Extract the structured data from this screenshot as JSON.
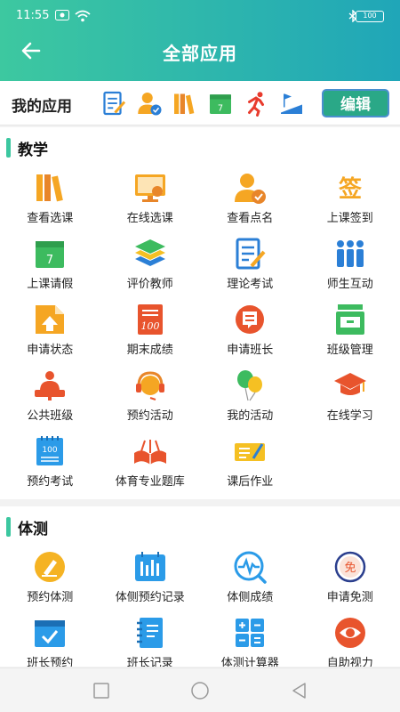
{
  "status": {
    "time": "11:55",
    "battery": "100"
  },
  "header": {
    "title": "全部应用"
  },
  "my_apps": {
    "label": "我的应用",
    "edit": "编辑",
    "icons": [
      "checklist-icon",
      "person-check-icon",
      "books-icon",
      "calendar-icon",
      "runner-icon",
      "podium-icon"
    ]
  },
  "sections": [
    {
      "title": "教学",
      "items": [
        {
          "label": "查看选课",
          "icon": "books-icon"
        },
        {
          "label": "在线选课",
          "icon": "monitor-icon"
        },
        {
          "label": "查看点名",
          "icon": "person-check-icon"
        },
        {
          "label": "上课签到",
          "icon": "sign-icon"
        },
        {
          "label": "上课请假",
          "icon": "calendar-icon"
        },
        {
          "label": "评价教师",
          "icon": "layers-icon"
        },
        {
          "label": "理论考试",
          "icon": "exam-icon"
        },
        {
          "label": "师生互动",
          "icon": "group-icon"
        },
        {
          "label": "申请状态",
          "icon": "upload-icon"
        },
        {
          "label": "期末成绩",
          "icon": "score-icon"
        },
        {
          "label": "申请班长",
          "icon": "chat-icon"
        },
        {
          "label": "班级管理",
          "icon": "cabinet-icon"
        },
        {
          "label": "公共班级",
          "icon": "teacher-icon"
        },
        {
          "label": "预约活动",
          "icon": "headset-icon"
        },
        {
          "label": "我的活动",
          "icon": "balloon-icon"
        },
        {
          "label": "在线学习",
          "icon": "graduation-icon"
        },
        {
          "label": "预约考试",
          "icon": "notepad-icon"
        },
        {
          "label": "体育专业题库",
          "icon": "open-book-icon"
        },
        {
          "label": "课后作业",
          "icon": "homework-icon"
        }
      ]
    },
    {
      "title": "体测",
      "items": [
        {
          "label": "预约体测",
          "icon": "edit-circle-icon"
        },
        {
          "label": "体侧预约记录",
          "icon": "bar-chart-icon"
        },
        {
          "label": "体侧成绩",
          "icon": "pulse-icon"
        },
        {
          "label": "申请免测",
          "icon": "exempt-icon"
        },
        {
          "label": "班长预约",
          "icon": "calendar-check-icon"
        },
        {
          "label": "班长记录",
          "icon": "notebook-icon"
        },
        {
          "label": "体测计算器",
          "icon": "calculator-icon"
        },
        {
          "label": "自助视力",
          "icon": "eye-icon"
        }
      ]
    }
  ]
}
